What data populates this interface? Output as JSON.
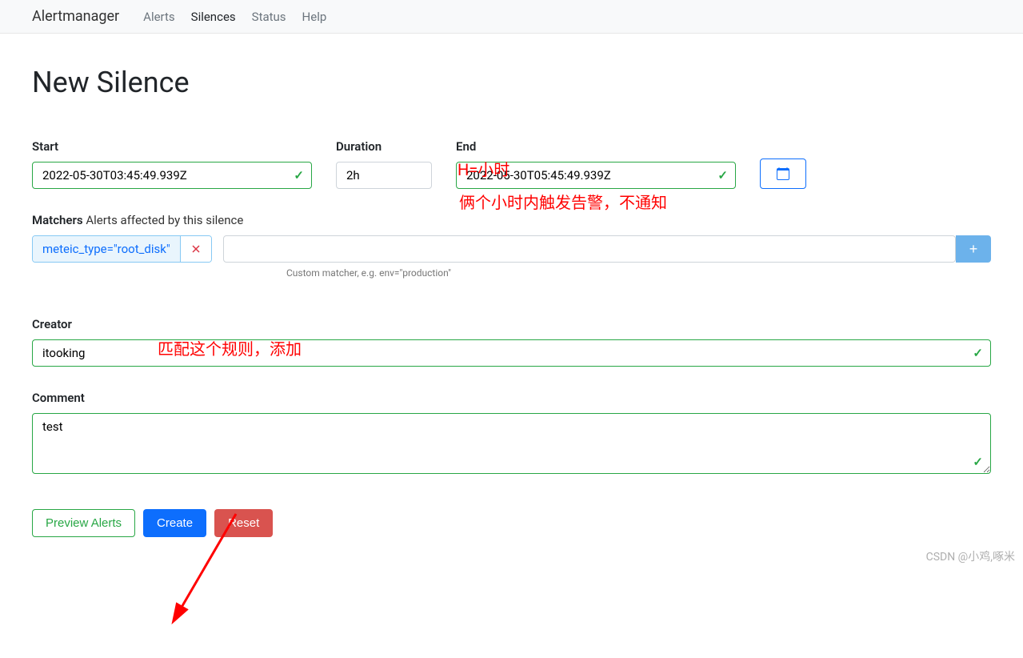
{
  "nav": {
    "brand": "Alertmanager",
    "links": [
      "Alerts",
      "Silences",
      "Status",
      "Help"
    ],
    "active_index": 1
  },
  "page": {
    "title": "New Silence"
  },
  "form": {
    "start_label": "Start",
    "start_value": "2022-05-30T03:45:49.939Z",
    "duration_label": "Duration",
    "duration_value": "2h",
    "end_label": "End",
    "end_value": "2022-05-30T05:45:49.939Z",
    "matchers_label": "Matchers",
    "matchers_sub": "Alerts affected by this silence",
    "matchers": [
      "meteic_type=\"root_disk\""
    ],
    "matcher_placeholder_hint": "Custom matcher, e.g.   env=\"production\"",
    "matcher_input_value": "",
    "creator_label": "Creator",
    "creator_value": "itooking",
    "comment_label": "Comment",
    "comment_value": "test"
  },
  "actions": {
    "preview": "Preview Alerts",
    "create": "Create",
    "reset": "Reset"
  },
  "annotations": {
    "a1": "H=小时",
    "a2": "俩个小时内触发告警，不通知",
    "a3": "匹配这个规则，添加"
  },
  "watermark": "CSDN @小鸡,啄米"
}
